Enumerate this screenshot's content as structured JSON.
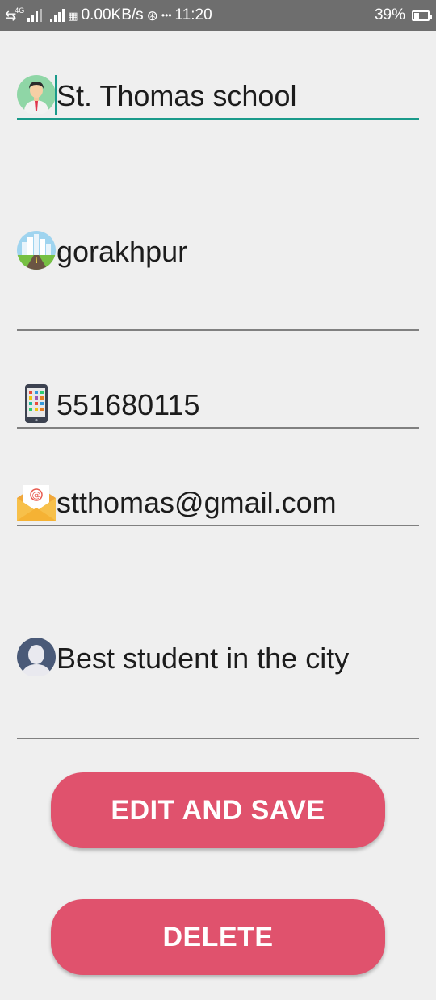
{
  "status_bar": {
    "network": "4G",
    "speed": "0.00KB/s",
    "more": "•••",
    "time": "11:20",
    "battery_percent": "39%",
    "battery_level": 0.39
  },
  "form": {
    "school_name": {
      "value": "St.  Thomas school",
      "icon": "person-avatar-icon"
    },
    "city": {
      "value": "gorakhpur",
      "icon": "city-icon"
    },
    "phone": {
      "value": "551680115",
      "icon": "mobile-phone-icon"
    },
    "email": {
      "value": "stthomas@gmail.com",
      "icon": "mail-envelope-icon"
    },
    "description": {
      "value": "Best student in the city",
      "icon": "user-silhouette-icon"
    }
  },
  "buttons": {
    "edit_save_label": "EDIT AND SAVE",
    "delete_label": "DELETE"
  },
  "colors": {
    "accent": "#1a9a8a",
    "button": "#e0526d",
    "status_bar": "#6e6e6e",
    "background": "#efefef"
  }
}
